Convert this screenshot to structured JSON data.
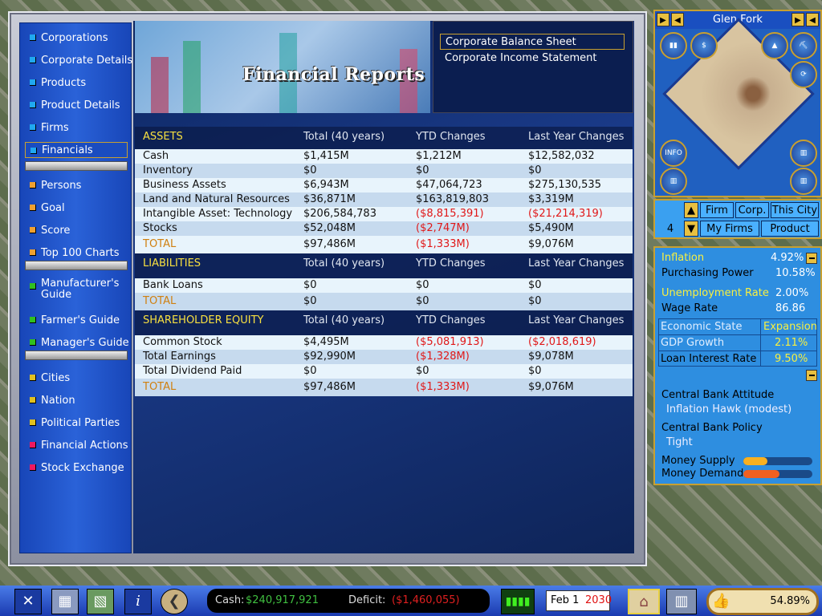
{
  "sidebar": {
    "items": [
      {
        "label": "Corporations",
        "color": "#20a8f0"
      },
      {
        "label": "Corporate Details",
        "color": "#20a8f0"
      },
      {
        "label": "Products",
        "color": "#20a8f0"
      },
      {
        "label": "Product Details",
        "color": "#20a8f0"
      },
      {
        "label": "Firms",
        "color": "#20a8f0"
      },
      {
        "label": "Financials",
        "color": "#20a8f0",
        "selected": true
      },
      {
        "label": "Persons",
        "color": "#f0a030"
      },
      {
        "label": "Goal",
        "color": "#f0a030"
      },
      {
        "label": "Score",
        "color": "#f0a030"
      },
      {
        "label": "Top 100 Charts",
        "color": "#f0a030"
      },
      {
        "label": "Manufacturer's Guide",
        "color": "#30c020"
      },
      {
        "label": "Farmer's Guide",
        "color": "#30c020"
      },
      {
        "label": "Manager's Guide",
        "color": "#30c020"
      },
      {
        "label": "Cities",
        "color": "#e0c020"
      },
      {
        "label": "Nation",
        "color": "#e0c020"
      },
      {
        "label": "Political Parties",
        "color": "#e0c020"
      },
      {
        "label": "Financial Actions",
        "color": "#f01860"
      },
      {
        "label": "Stock Exchange",
        "color": "#f01860"
      }
    ]
  },
  "banner": {
    "title": "Financial Reports"
  },
  "reports": {
    "items": [
      "Corporate Balance Sheet",
      "Corporate Income Statement"
    ],
    "selected": 0
  },
  "table": {
    "sections": [
      {
        "title": "ASSETS",
        "columns": [
          "Total (40 years)",
          "YTD Changes",
          "Last Year Changes"
        ],
        "rows": [
          [
            "Cash",
            "$1,415M",
            "$1,212M",
            "$12,582,032"
          ],
          [
            "Inventory",
            "$0",
            "$0",
            "$0"
          ],
          [
            "Business Assets",
            "$6,943M",
            "$47,064,723",
            "$275,130,535"
          ],
          [
            "Land and Natural Resources",
            "$36,871M",
            "$163,819,803",
            "$3,319M"
          ],
          [
            "Intangible Asset: Technology",
            "$206,584,783",
            "($8,815,391)",
            "($21,214,319)"
          ],
          [
            "Stocks",
            "$52,048M",
            "($2,747M)",
            "$5,490M"
          ]
        ],
        "total": [
          "TOTAL",
          "$97,486M",
          "($1,333M)",
          "$9,076M"
        ]
      },
      {
        "title": "LIABILITIES",
        "columns": [
          "Total (40 years)",
          "YTD Changes",
          "Last Year Changes"
        ],
        "rows": [
          [
            "Bank Loans",
            "$0",
            "$0",
            "$0"
          ]
        ],
        "total": [
          "TOTAL",
          "$0",
          "$0",
          "$0"
        ]
      },
      {
        "title": "SHAREHOLDER EQUITY",
        "columns": [
          "Total (40 years)",
          "YTD Changes",
          "Last Year Changes"
        ],
        "rows": [
          [
            "Common Stock",
            "$4,495M",
            "($5,081,913)",
            "($2,018,619)"
          ],
          [
            "Total Earnings",
            "$92,990M",
            "($1,328M)",
            "$9,078M"
          ],
          [
            "Total Dividend Paid",
            "$0",
            "$0",
            "$0"
          ]
        ],
        "total": [
          "TOTAL",
          "$97,486M",
          "($1,333M)",
          "$9,076M"
        ]
      }
    ]
  },
  "map": {
    "city": "Glen Fork",
    "info": "INFO"
  },
  "controls": {
    "number": "4",
    "firm": "Firm",
    "corp": "Corp.",
    "this_city": "This City",
    "my_firms": "My Firms",
    "product": "Product"
  },
  "econ": {
    "inflation_label": "Inflation",
    "inflation": "4.92%",
    "purchasing_label": "Purchasing Power",
    "purchasing": "10.58%",
    "unemp_label": "Unemployment Rate",
    "unemp": "2.00%",
    "wage_label": "Wage Rate",
    "wage": "86.86",
    "state_label": "Economic State",
    "state": "Expansion",
    "gdp_label": "GDP Growth",
    "gdp": "2.11%",
    "loan_label": "Loan Interest Rate",
    "loan": "9.50%",
    "attitude_label": "Central Bank Attitude",
    "attitude": "Inflation Hawk (modest)",
    "policy_label": "Central Bank Policy",
    "policy": "Tight",
    "supply_label": "Money Supply",
    "supply_level": 0.35,
    "demand_label": "Money Demand",
    "demand_level": 0.52
  },
  "status": {
    "cash_label": "Cash:",
    "cash": "$240,917,921",
    "deficit_label": "Deficit:",
    "deficit": "($1,460,055)",
    "date": "Feb 1",
    "year": "2030",
    "approval": "54.89%"
  }
}
